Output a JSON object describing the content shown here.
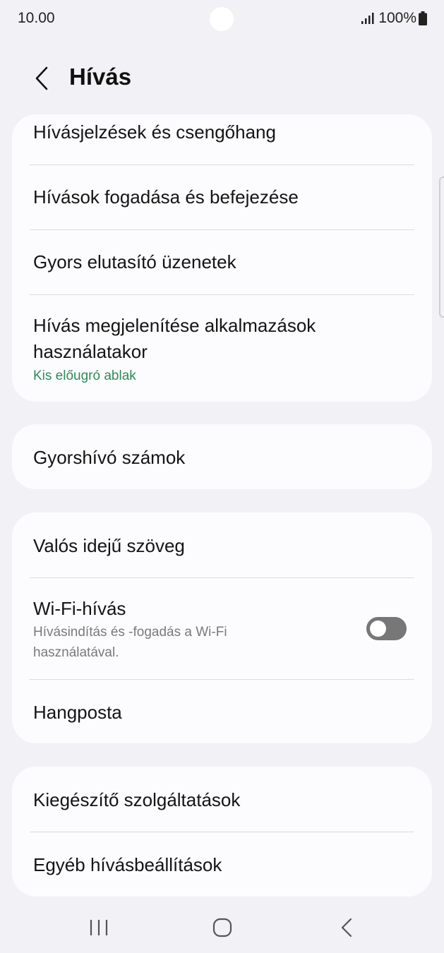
{
  "status_bar": {
    "time": "10.00",
    "battery": "100%"
  },
  "header": {
    "title": "Hívás"
  },
  "card1": {
    "items": [
      {
        "label": "Hívásjelzések és csengőhang"
      },
      {
        "label": "Hívások fogadása és befejezése"
      },
      {
        "label": "Gyors elutasító üzenetek"
      },
      {
        "label_line1": "Hívás megjelenítése alkalmazások",
        "label_line2": "használatakor",
        "sub": "Kis előugró ablak"
      }
    ]
  },
  "card2": {
    "items": [
      {
        "label": "Gyorshívó számok"
      }
    ]
  },
  "card3": {
    "items": [
      {
        "label": "Valós idejű szöveg"
      },
      {
        "label": "Wi-Fi-hívás",
        "sub_line1": "Hívásindítás és -fogadás a Wi-Fi",
        "sub_line2": "használatával.",
        "toggle": "off"
      },
      {
        "label": "Hangposta"
      }
    ]
  },
  "card4": {
    "items": [
      {
        "label": "Kiegészítő szolgáltatások"
      },
      {
        "label": "Egyéb hívásbeállítások"
      }
    ]
  },
  "colors": {
    "accent_green": "#2e8b57",
    "background": "#f2f2f6",
    "card": "#fcfcff"
  },
  "icons": [
    "signal-icon",
    "battery-icon",
    "back-arrow-icon",
    "recent-apps-icon",
    "home-icon",
    "nav-back-icon"
  ]
}
